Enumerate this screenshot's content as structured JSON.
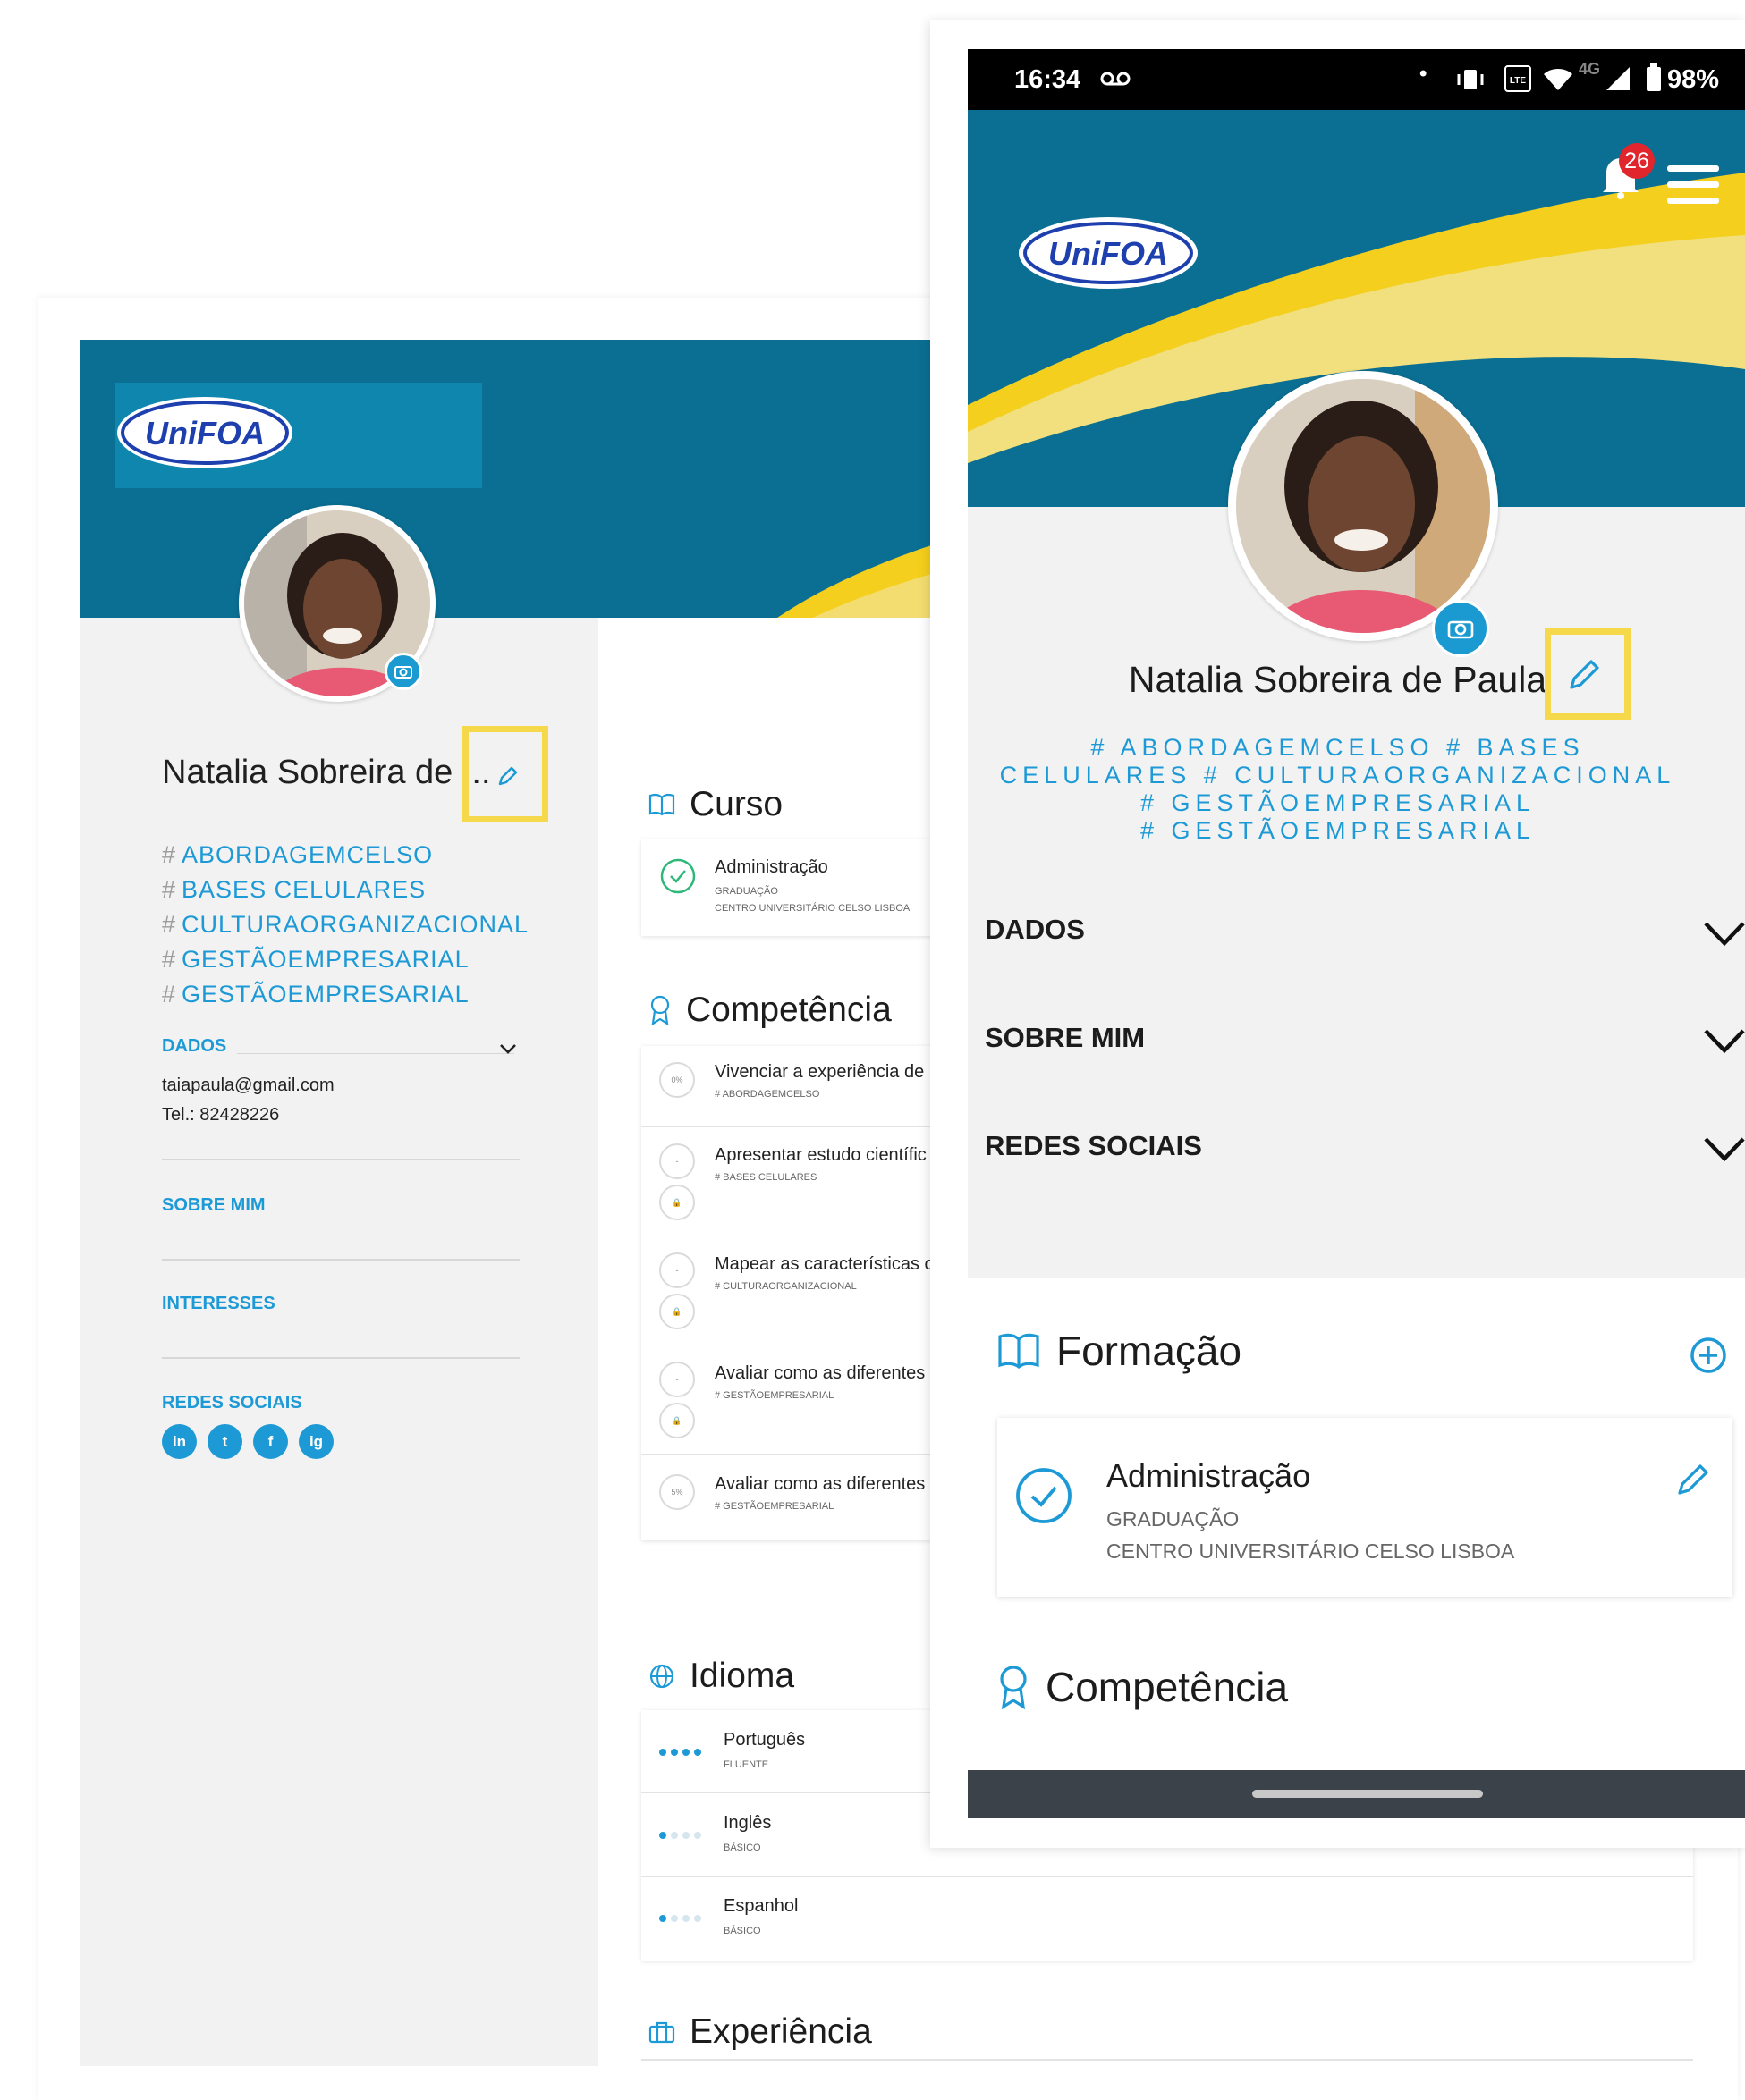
{
  "desktop": {
    "logo_text": "UniFOA",
    "profile": {
      "name": "Natalia Sobreira de ...",
      "tags": [
        "ABORDAGEMCELSO",
        "BASES CELULARES",
        "CULTURAORGANIZACIONAL",
        "GESTÃOEMPRESARIAL",
        "GESTÃOEMPRESARIAL"
      ]
    },
    "hash": "#",
    "sections": {
      "dados": "DADOS",
      "email": "taiapaula@gmail.com",
      "phone": "Tel.: 82428226",
      "sobre": "SOBRE MIM",
      "interesses": "INTERESSES",
      "redes": "REDES SOCIAIS"
    },
    "social": [
      "in",
      "t",
      "f",
      "ig"
    ],
    "curso": {
      "title": "Curso",
      "items": [
        {
          "name": "Administração",
          "level": "GRADUAÇÃO",
          "institution": "CENTRO UNIVERSITÁRIO CELSO LISBOA"
        }
      ]
    },
    "competencia": {
      "title": "Competência",
      "items": [
        {
          "label": "Vivenciar a experiência de",
          "tag": "# ABORDAGEMCELSO",
          "badge": "0%"
        },
        {
          "label": "Apresentar estudo científic",
          "tag": "# BASES CELULARES",
          "badge": "-"
        },
        {
          "label": "Mapear as características c",
          "tag": "# CULTURAORGANIZACIONAL",
          "badge": "-"
        },
        {
          "label": "Avaliar como as diferentes",
          "tag": "# GESTÃOEMPRESARIAL",
          "badge": "-"
        },
        {
          "label": "Avaliar como as diferentes",
          "tag": "# GESTÃOEMPRESARIAL",
          "badge": "5%"
        }
      ]
    },
    "idioma": {
      "title": "Idioma",
      "items": [
        {
          "name": "Português",
          "level": "FLUENTE",
          "dots": 4
        },
        {
          "name": "Inglês",
          "level": "BÁSICO",
          "dots": 1
        },
        {
          "name": "Espanhol",
          "level": "BÁSICO",
          "dots": 1
        }
      ]
    },
    "experiencia": {
      "title": "Experiência"
    }
  },
  "phone": {
    "status": {
      "time": "16:34",
      "battery": "98%",
      "network": "4G"
    },
    "notification_count": "26",
    "logo_text": "UniFOA",
    "profile": {
      "name": "Natalia Sobreira de Paula",
      "tags_line1": "# ABORDAGEMCELSO  # BASES",
      "tags_line2": "CELULARES  # CULTURAORGANIZACIONAL",
      "tags_line3": "# GESTÃOEMPRESARIAL",
      "tags_line4": "# GESTÃOEMPRESARIAL"
    },
    "accordions": [
      "DADOS",
      "SOBRE MIM",
      "REDES SOCIAIS"
    ],
    "formacao": {
      "title": "Formação",
      "item": {
        "name": "Administração",
        "level": "GRADUAÇÃO",
        "institution": "CENTRO UNIVERSITÁRIO CELSO LISBOA"
      }
    },
    "competencia_title": "Competência"
  },
  "colors": {
    "brand_blue": "#0a6f93",
    "accent": "#1d9ad6",
    "yellow": "#f4cf1d",
    "highlight": "#f6d94a",
    "badge_red": "#e0252c"
  }
}
